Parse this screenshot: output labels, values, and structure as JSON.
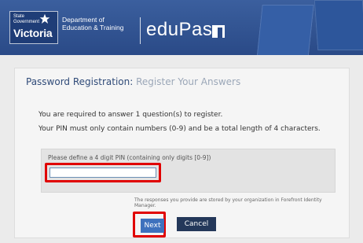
{
  "header": {
    "logo_small": "State\nGovernment",
    "logo_main": "Victoria",
    "department": "Department of\nEducation & Training",
    "brand": "eduPass"
  },
  "page": {
    "heading_prefix": "Password Registration:",
    "heading_suffix": "Register Your Answers",
    "instruction1": "You are required to answer 1 question(s) to register.",
    "instruction2": "Your PIN must only contain numbers (0-9) and be a total length of 4 characters."
  },
  "form": {
    "pin_label": "Please define a 4 digit PIN (containing only digits [0-9])",
    "pin_value": "",
    "note": "The responses you provide are stored by your organization in Forefront Identity Manager.",
    "next_label": "Next",
    "cancel_label": "Cancel"
  },
  "colors": {
    "banner": "#2a4a87",
    "highlight": "#e00000",
    "next_button": "#3e71bd",
    "cancel_button": "#24385a"
  },
  "icons": [
    "star-logo-icon",
    "edupass-square-icon"
  ]
}
